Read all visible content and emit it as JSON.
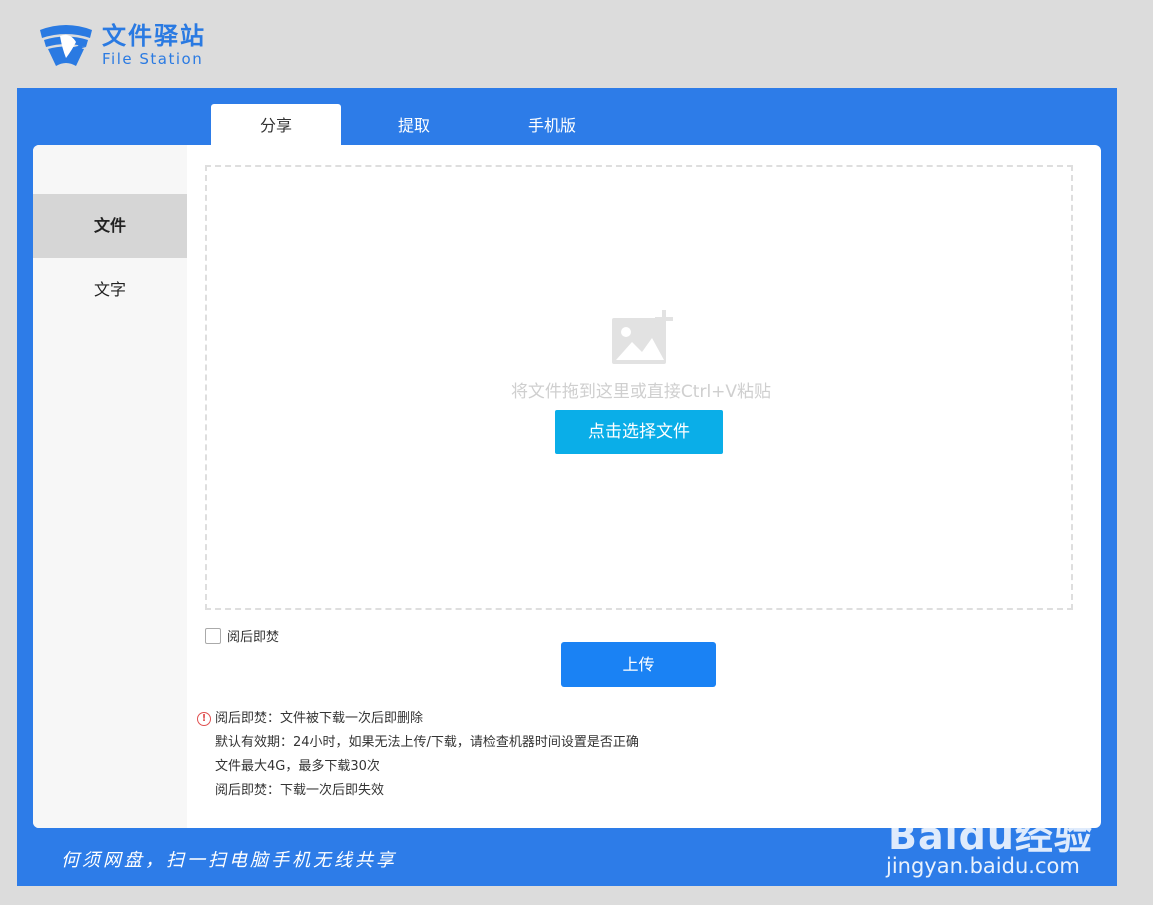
{
  "header": {
    "logo_cn": "文件驿站",
    "logo_en": "File Station"
  },
  "tabs": [
    {
      "label": "分享",
      "active": true
    },
    {
      "label": "提取",
      "active": false
    },
    {
      "label": "手机版",
      "active": false
    }
  ],
  "sidebar": {
    "items": [
      {
        "label": "文件",
        "active": true
      },
      {
        "label": "文字",
        "active": false
      }
    ]
  },
  "dropzone": {
    "icon": "image-add-icon",
    "hint": "将文件拖到这里或直接Ctrl+V粘贴",
    "select_label": "点击选择文件"
  },
  "burn_after_read": {
    "label": "阅后即焚",
    "checked": false
  },
  "upload_label": "上传",
  "notes": [
    "阅后即焚：文件被下载一次后即删除",
    "默认有效期：24小时，如果无法上传/下载，请检查机器时间设置是否正确",
    "文件最大4G，最多下载30次",
    "阅后即焚：下载一次后即失效"
  ],
  "footer": {
    "slogan": "何须网盘，扫一扫电脑手机无线共享"
  },
  "watermark": {
    "brand": "Baidu经验",
    "url": "jingyan.baidu.com"
  },
  "colors": {
    "frame_blue": "#2d7ce8",
    "select_button": "#0aaee8",
    "upload_button": "#1a82f4",
    "warning": "#e05050"
  }
}
